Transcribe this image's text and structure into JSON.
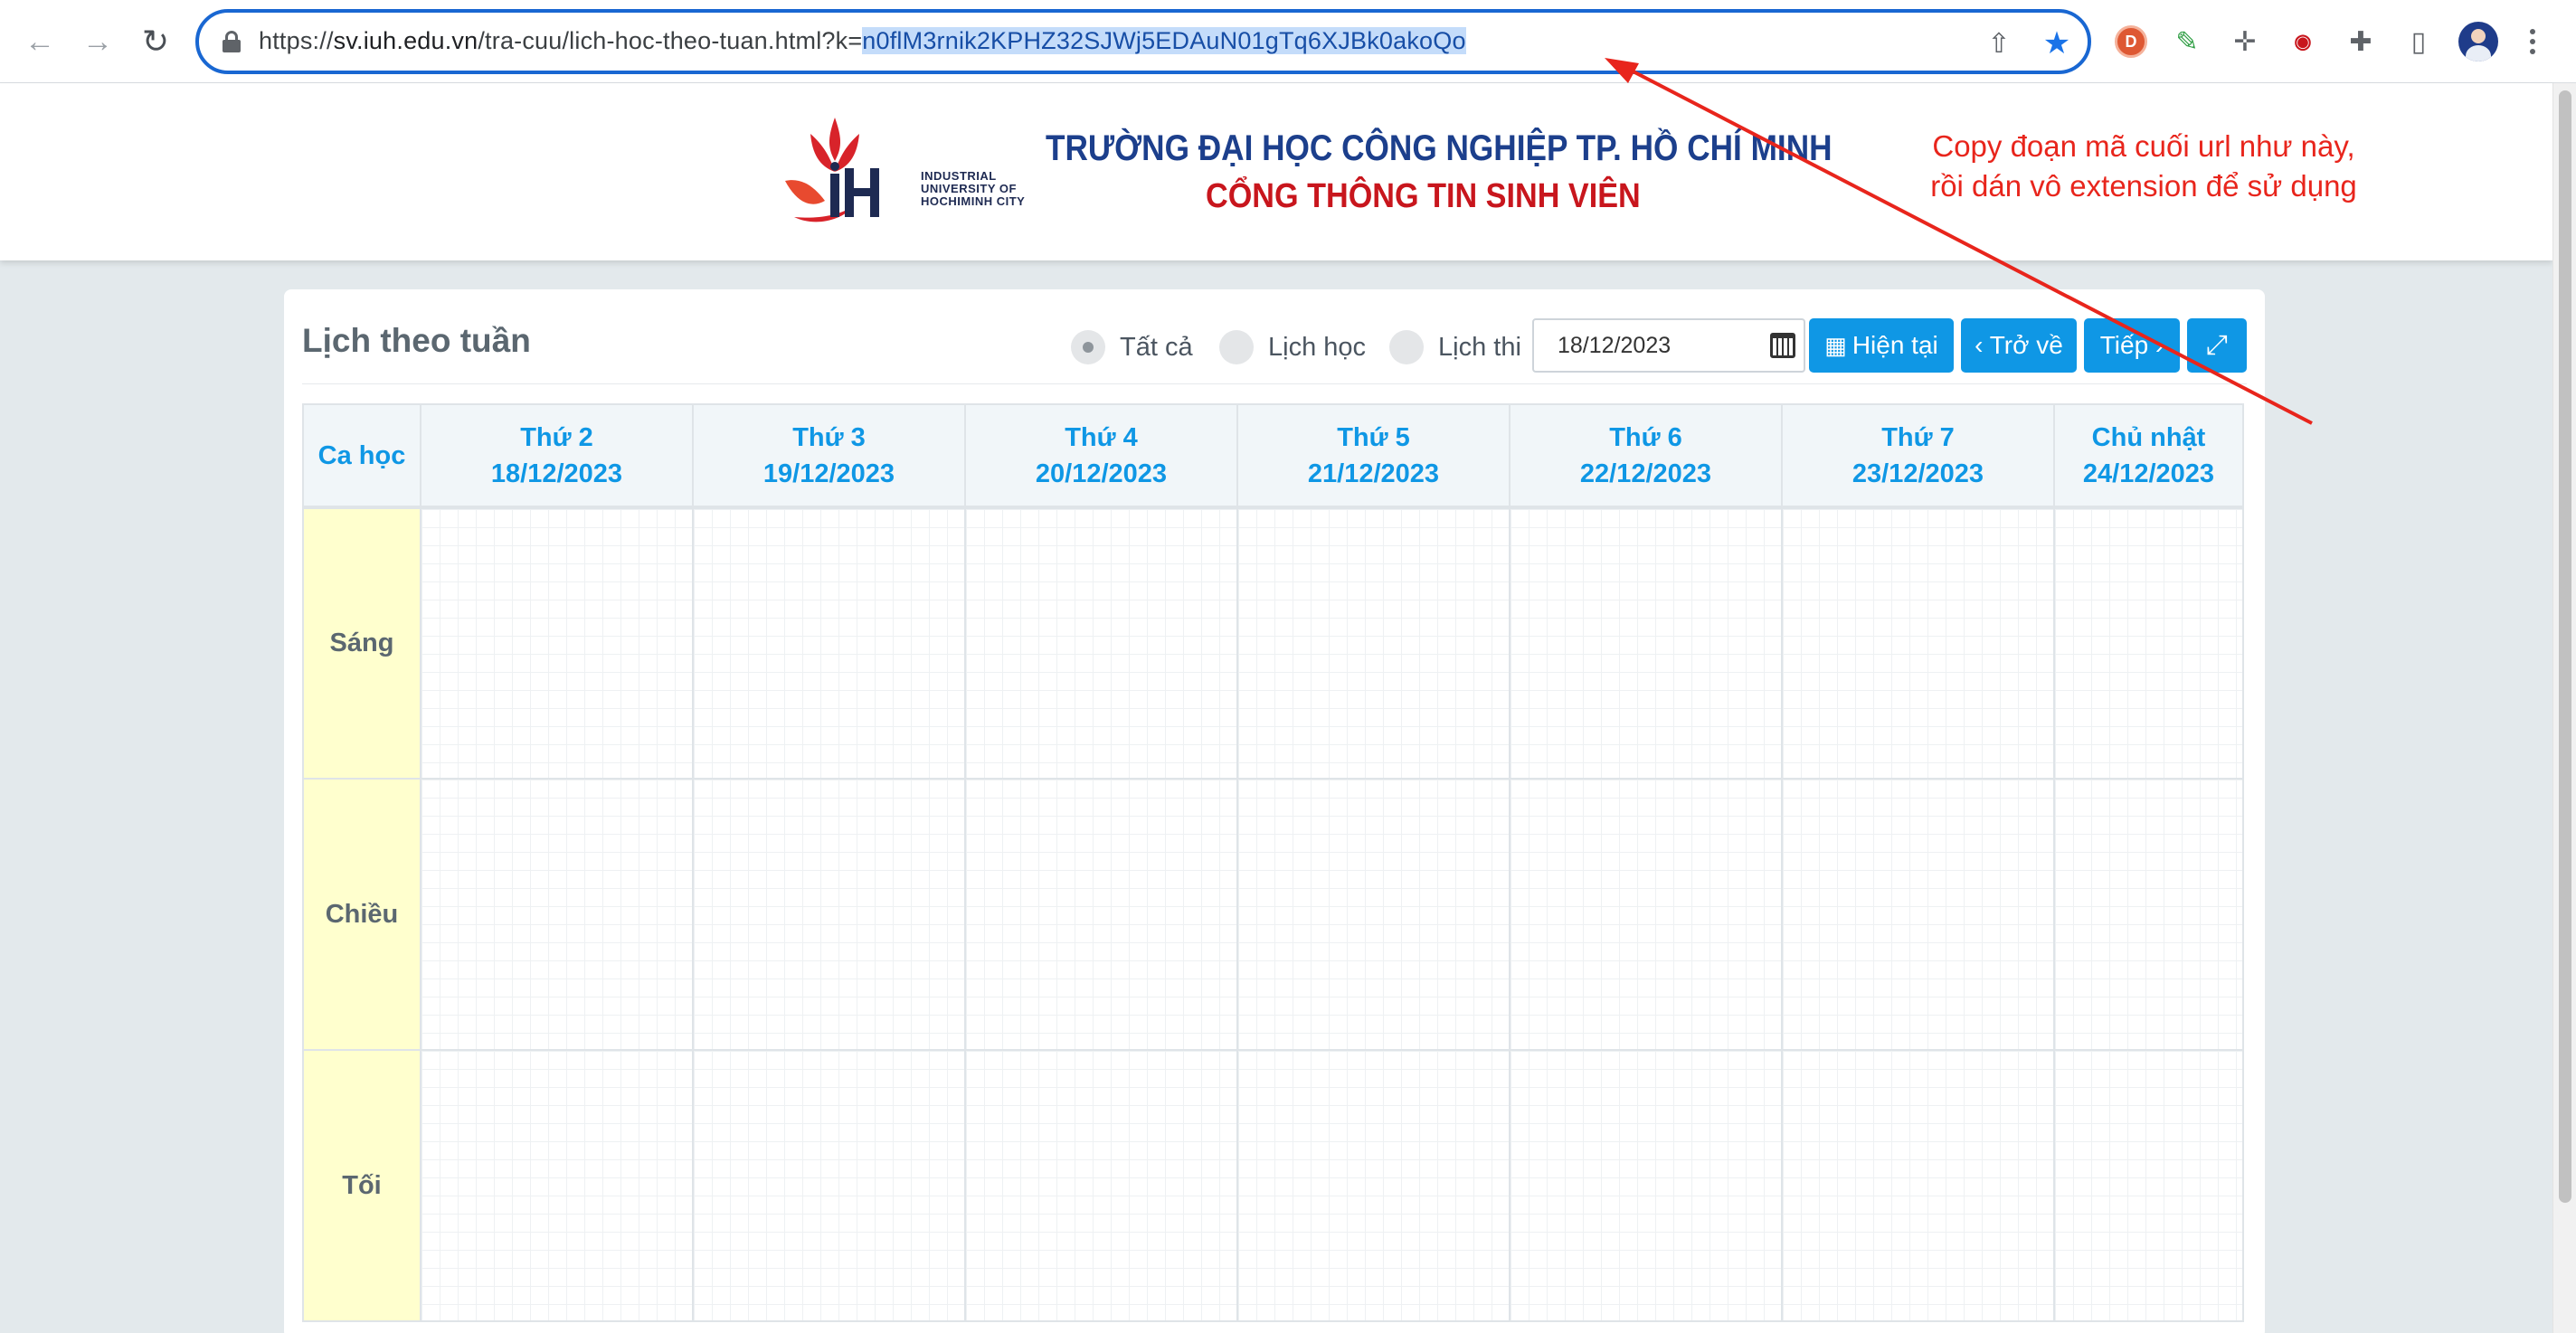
{
  "browser": {
    "url_prefix": "https://",
    "url_domain": "sv.iuh.edu.vn",
    "url_path": "/tra-cuu/lich-hoc-theo-tuan.html?k=",
    "url_selected": "n0flM3rnik2KPHZ32SJWj5EDAuN01gTq6XJBk0akoQo",
    "extensions": [
      "duckduckgo-icon",
      "color-picker-icon",
      "ruler-icon",
      "iuh-extension-icon",
      "puzzle-icon",
      "side-panel-icon",
      "profile-avatar"
    ]
  },
  "header": {
    "logo_text": "INDUSTRIAL UNIVERSITY OF HOCHIMINH CITY",
    "school_name": "TRƯỜNG ĐẠI HỌC CÔNG NGHIỆP TP. HỒ CHÍ MINH",
    "portal_name": "CỔNG THÔNG TIN SINH VIÊN"
  },
  "annotation": {
    "line1": "Copy đoạn mã cuối url như này,",
    "line2": "rồi dán vô extension để sử dụng",
    "color": "#e8251c"
  },
  "panel": {
    "title": "Lịch theo tuần",
    "filters": [
      {
        "label": "Tất cả",
        "checked": true
      },
      {
        "label": "Lịch học",
        "checked": false
      },
      {
        "label": "Lịch thi",
        "checked": false
      }
    ],
    "date_value": "18/12/2023",
    "buttons": {
      "current": "Hiện tại",
      "back": "‹ Trở về",
      "next": "Tiếp ›"
    }
  },
  "schedule": {
    "corner_label": "Ca học",
    "days": [
      {
        "name": "Thứ 2",
        "date": "18/12/2023"
      },
      {
        "name": "Thứ 3",
        "date": "19/12/2023"
      },
      {
        "name": "Thứ 4",
        "date": "20/12/2023"
      },
      {
        "name": "Thứ 5",
        "date": "21/12/2023"
      },
      {
        "name": "Thứ 6",
        "date": "22/12/2023"
      },
      {
        "name": "Thứ 7",
        "date": "23/12/2023"
      },
      {
        "name": "Chủ nhật",
        "date": "24/12/2023"
      }
    ],
    "slots": [
      "Sáng",
      "Chiều",
      "Tối"
    ]
  },
  "colors": {
    "accent": "#0f97e5",
    "slot_bg": "#ffffce",
    "school_blue": "#1c3f8c",
    "portal_red": "#c8161d"
  }
}
